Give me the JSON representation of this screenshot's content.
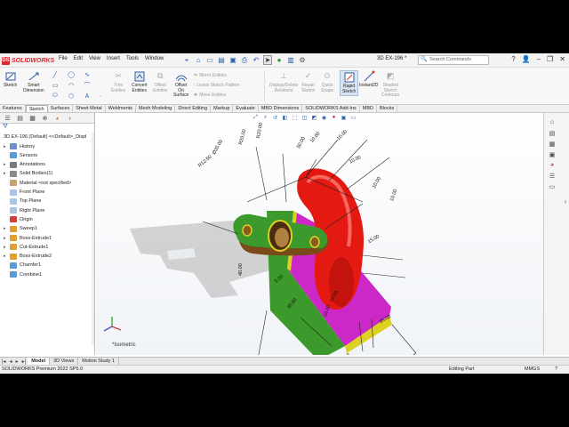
{
  "app": {
    "brand": "SOLIDWORKS",
    "doc_name": "3D EX-196 *",
    "search_placeholder": "Search Commands"
  },
  "menu": [
    "File",
    "Edit",
    "View",
    "Insert",
    "Tools",
    "Window"
  ],
  "ribbon": {
    "sketch": "Sketch",
    "smart_dimension": [
      "Smart",
      "Dimension"
    ],
    "trim_entities": [
      "Trim",
      "Entities"
    ],
    "convert_entities": [
      "Convert",
      "Entities"
    ],
    "offset_entities": [
      "Offset",
      "Entities"
    ],
    "offset_on_surface": [
      "Offset",
      "On",
      "Surface"
    ],
    "mirror_entities": "Mirror Entities",
    "linear_sketch_pattern": "Linear Sketch Pattern",
    "move_entities": "Move Entities",
    "display_delete_relations": [
      "Display/Delete",
      "Relations"
    ],
    "repair_sketch": [
      "Repair",
      "Sketch"
    ],
    "quick_snaps": [
      "Quick",
      "Snaps"
    ],
    "rapid_sketch": [
      "Rapid",
      "Sketch"
    ],
    "instant2d": "Instant2D",
    "shaded_sketch_contours": [
      "Shaded",
      "Sketch",
      "Contours"
    ]
  },
  "tabs": [
    "Features",
    "Sketch",
    "Surfaces",
    "Sheet Metal",
    "Weldments",
    "Mesh Modeling",
    "Direct Editing",
    "Markup",
    "Evaluate",
    "MBD Dimensions",
    "SOLIDWORKS Add-Ins",
    "MBD",
    "Blocks"
  ],
  "active_tab": "Sketch",
  "tree": {
    "root": "3D EX-196 (Default) <<Default>_Displ",
    "items": [
      {
        "label": "History",
        "icon": "history-icon",
        "color": "#6b8fc7"
      },
      {
        "label": "Sensors",
        "icon": "sensor-icon",
        "color": "#5b9bd5"
      },
      {
        "label": "Annotations",
        "icon": "annotation-icon",
        "color": "#7a7a7a"
      },
      {
        "label": "Solid Bodies(1)",
        "icon": "solid-bodies-icon",
        "color": "#8a8a8a"
      },
      {
        "label": "Material <not specified>",
        "icon": "material-icon",
        "color": "#c9a070"
      },
      {
        "label": "Front Plane",
        "icon": "plane-icon",
        "color": "#a9c4e6"
      },
      {
        "label": "Top Plane",
        "icon": "plane-icon",
        "color": "#a9c4e6"
      },
      {
        "label": "Right Plane",
        "icon": "plane-icon",
        "color": "#a9c4e6"
      },
      {
        "label": "Origin",
        "icon": "origin-icon",
        "color": "#d04040"
      },
      {
        "label": "Sweep1",
        "icon": "sweep-icon",
        "color": "#e0a030"
      },
      {
        "label": "Boss-Extrude1",
        "icon": "extrude-icon",
        "color": "#e0a030"
      },
      {
        "label": "Cut-Extrude1",
        "icon": "cut-icon",
        "color": "#e0a030"
      },
      {
        "label": "Boss-Extrude2",
        "icon": "extrude-icon",
        "color": "#e0a030"
      },
      {
        "label": "Chamfer1",
        "icon": "chamfer-icon",
        "color": "#5b9bd5"
      },
      {
        "label": "Combine1",
        "icon": "combine-icon",
        "color": "#5b9bd5"
      }
    ]
  },
  "dimensions": [
    "R12.50",
    "Ø20.00",
    "R20.00",
    "R20.00",
    "50.00",
    "10.00",
    "10.00",
    "10.00",
    "15.00",
    "10.00",
    "10.00",
    "5.00",
    "30.00",
    "10.00",
    "40.00",
    "10.00",
    "65.00"
  ],
  "view_label": "*Isometric",
  "bottom_tabs": [
    "Model",
    "3D Views",
    "Motion Study 1"
  ],
  "active_bottom_tab": "Model",
  "status": {
    "version": "SOLIDWORKS Premium 2022 SP5.0",
    "mode": "Editing Part",
    "units": "MMGS"
  },
  "colors": {
    "face_green": "#3c9a2c",
    "face_magenta": "#cc28c8",
    "face_red": "#e41a12",
    "face_yellow": "#dcd020",
    "face_brown": "#7a4a18"
  }
}
